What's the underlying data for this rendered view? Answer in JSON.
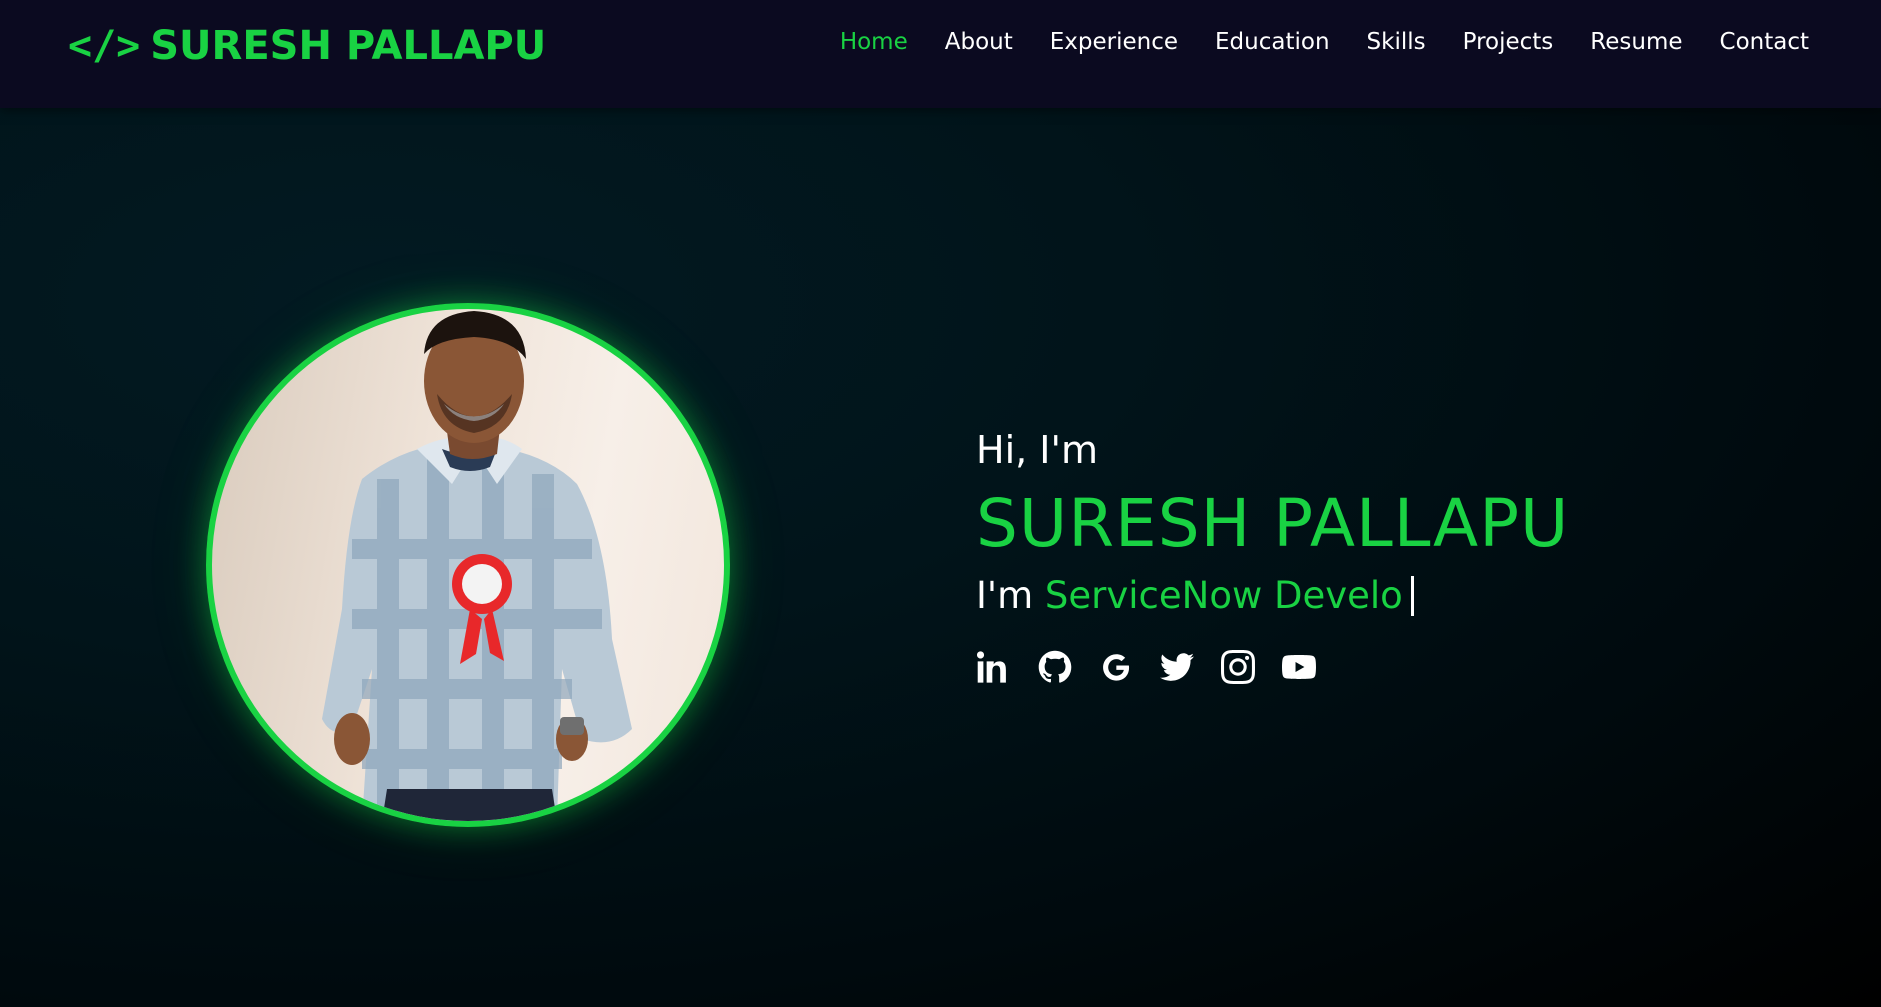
{
  "brand": {
    "icon": "</>",
    "name": "SURESH PALLAPU"
  },
  "nav": {
    "items": [
      {
        "label": "Home",
        "active": true
      },
      {
        "label": "About"
      },
      {
        "label": "Experience"
      },
      {
        "label": "Education"
      },
      {
        "label": "Skills"
      },
      {
        "label": "Projects"
      },
      {
        "label": "Resume"
      },
      {
        "label": "Contact"
      }
    ]
  },
  "hero": {
    "photo_icon": "profile-photo",
    "greeting": "Hi, I'm",
    "name": "SURESH PALLAPU",
    "role_prefix": "I'm",
    "role_text": "ServiceNow Develo"
  },
  "socials": [
    {
      "icon": "linkedin-icon"
    },
    {
      "icon": "github-icon"
    },
    {
      "icon": "google-icon"
    },
    {
      "icon": "twitter-icon"
    },
    {
      "icon": "instagram-icon"
    },
    {
      "icon": "youtube-icon"
    }
  ],
  "colors": {
    "accent": "#19d243",
    "nav_bg": "#0b0a20",
    "text": "#ffffff"
  }
}
